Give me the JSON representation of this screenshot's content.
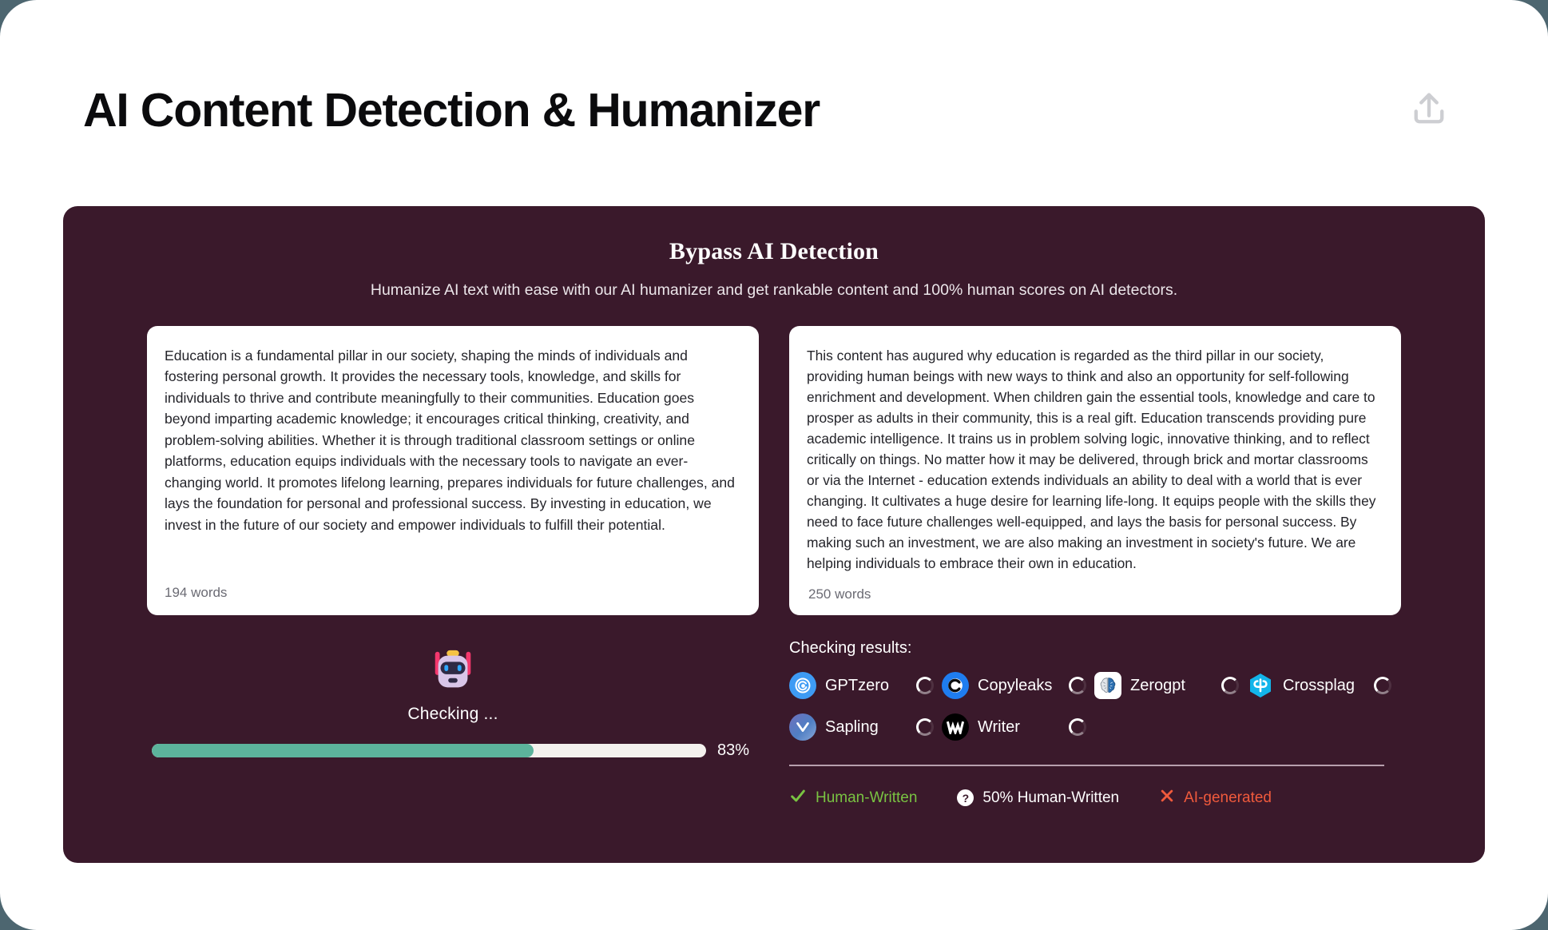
{
  "header": {
    "title": "AI Content Detection & Humanizer",
    "upload_icon": "upload-icon"
  },
  "panel": {
    "title": "Bypass AI Detection",
    "subtitle": "Humanize AI text with ease with our AI humanizer and get rankable content and 100% human scores on AI detectors."
  },
  "input_card": {
    "text": "Education is a fundamental pillar in our society, shaping the minds of individuals and fostering personal growth. It provides the necessary tools, knowledge, and skills for individuals to thrive and contribute meaningfully to their communities. Education goes beyond imparting academic knowledge; it encourages critical thinking, creativity, and problem-solving abilities. Whether it is through traditional classroom settings or online platforms, education equips individuals with the necessary tools to navigate an ever-changing world. It promotes lifelong learning, prepares individuals for future challenges, and lays the foundation for personal and professional success. By investing in education, we invest in the future of our society and empower individuals to fulfill their potential.",
    "word_count": "194 words"
  },
  "output_card": {
    "text": "This content has augured why education is regarded as the third pillar in our society, providing human beings with new ways to think and also an opportunity for self-following enrichment and development. When children gain the essential tools, knowledge and care to prosper as adults in their community, this is a real gift. Education transcends providing pure academic intelligence. It trains us in problem solving logic, innovative thinking, and to reflect critically on things. No matter how it may be delivered, through brick and mortar classrooms or via the Internet - education extends individuals an ability to deal with a world that is ever changing. It cultivates a huge desire for learning life-long. It equips people with the skills they need to face future challenges well-equipped, and lays the basis for personal success. By making such an investment, we are also making an investment in society's future. We are helping individuals to embrace their own in education.",
    "word_count": "250 words"
  },
  "progress": {
    "robot_icon": "robot-icon",
    "status_label": "Checking ...",
    "percent_label": "83%",
    "percent_value": 83,
    "fill_color": "#5cb39c",
    "track_color": "#f4f1ee"
  },
  "results": {
    "title": "Checking results:",
    "detectors": [
      {
        "name": "GPTzero",
        "icon": "gptzero-icon",
        "state": "loading"
      },
      {
        "name": "Copyleaks",
        "icon": "copyleaks-icon",
        "state": "loading"
      },
      {
        "name": "Zerogpt",
        "icon": "zerogpt-icon",
        "state": "loading"
      },
      {
        "name": "Crossplag",
        "icon": "crossplag-icon",
        "state": "loading"
      },
      {
        "name": "Sapling",
        "icon": "sapling-icon",
        "state": "loading"
      },
      {
        "name": "Writer",
        "icon": "writer-icon",
        "state": "loading"
      }
    ],
    "legend": [
      {
        "label": "Human-Written",
        "icon": "check-icon",
        "color": "#79c342"
      },
      {
        "label": "50% Human-Written",
        "icon": "question-icon",
        "color": "#ffffff"
      },
      {
        "label": "AI-generated",
        "icon": "cross-icon",
        "color": "#f05a3c"
      }
    ]
  },
  "theme": {
    "page_background": "#4d6670",
    "surface": "#ffffff",
    "panel_background": "#3a192b"
  }
}
